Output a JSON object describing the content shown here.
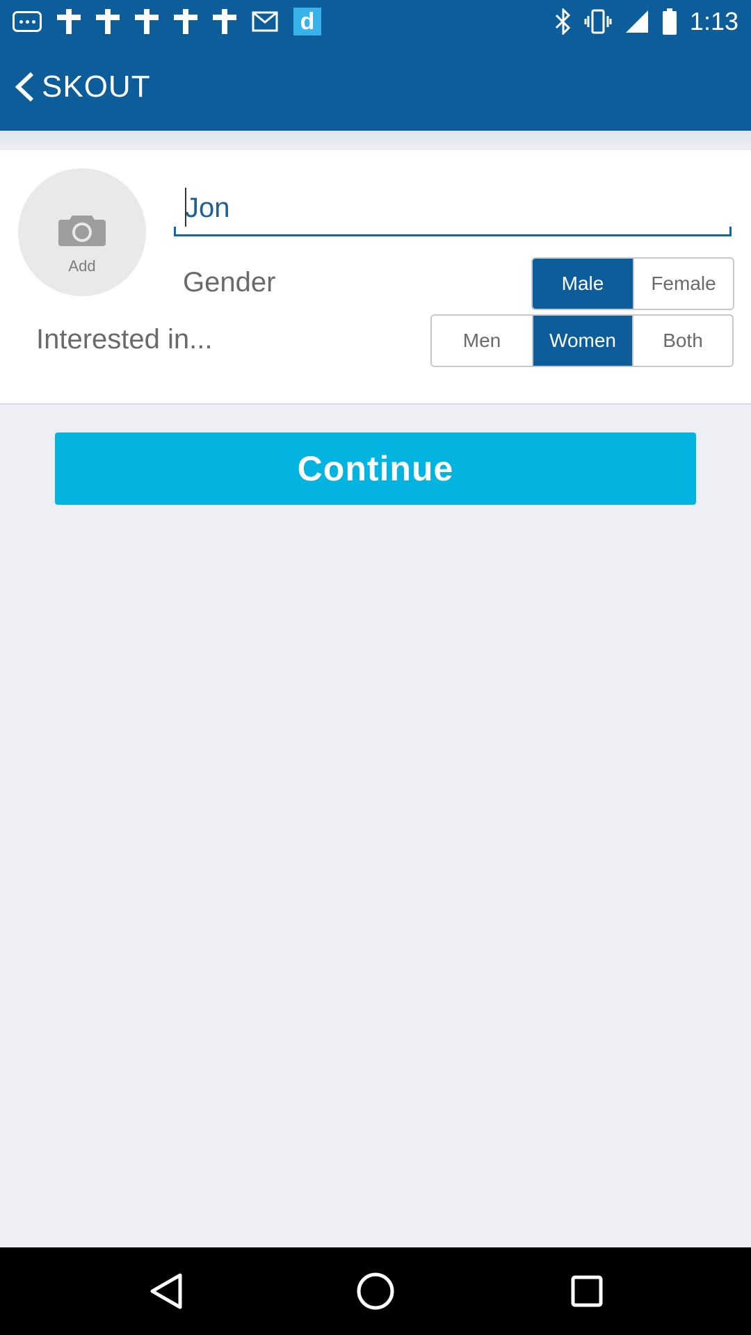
{
  "status_bar": {
    "time": "1:13",
    "notification_icons": [
      "more-icon",
      "crossword-icon",
      "crossword-icon",
      "crossword-icon",
      "crossword-icon",
      "crossword-icon",
      "mail-icon",
      "d-app-icon"
    ],
    "d_app_letter": "d",
    "system_icons": [
      "bluetooth-icon",
      "vibrate-icon",
      "signal-icon",
      "battery-icon"
    ]
  },
  "app_bar": {
    "title": "SKOUT",
    "back_icon": "chevron-left-icon"
  },
  "profile": {
    "photo_label": "Add",
    "photo_icon": "camera-icon",
    "name_value": "Jon",
    "gender_label": "Gender",
    "gender_options": [
      "Male",
      "Female"
    ],
    "gender_selected": "Male",
    "interest_label": "Interested in...",
    "interest_options": [
      "Men",
      "Women",
      "Both"
    ],
    "interest_selected": "Women"
  },
  "continue_label": "Continue",
  "nav_bar": {
    "icons": [
      "back-triangle-icon",
      "home-circle-icon",
      "recents-square-icon"
    ]
  },
  "colors": {
    "primary": "#0d5d9b",
    "accent": "#02b4df",
    "background": "#eeeff4"
  }
}
